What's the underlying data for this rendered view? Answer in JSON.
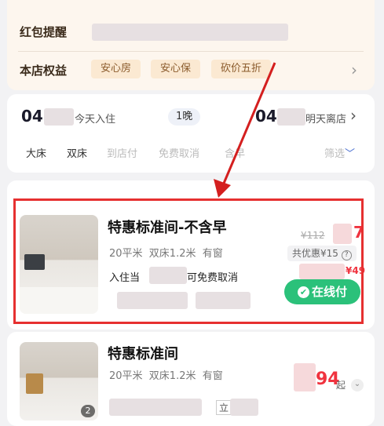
{
  "promo": {
    "label": "红包提醒",
    "benefits_label": "本店权益",
    "tags": [
      "安心房",
      "安心保",
      "砍价五折"
    ]
  },
  "dates": {
    "checkin_prefix": "04",
    "checkin_suffix": "今天入住",
    "nights": "1晚",
    "checkout_prefix": "04-",
    "checkout_suffix": "明天离店"
  },
  "filters": {
    "items": [
      "大床",
      "双床",
      "到店付",
      "免费取消",
      "含早"
    ],
    "more_label": "筛选"
  },
  "rooms": [
    {
      "title": "特惠标准间-不含早",
      "meta": "20平米  双床1.2米  有窗",
      "note": "入住当",
      "note_tail": "可免费取消",
      "original_price": "¥112",
      "discount_label": "共优惠¥15",
      "price_head": "7",
      "price_tail": "¥49",
      "pay_label": "在线付"
    },
    {
      "title": "特惠标准间",
      "meta": "20平米  双床1.2米  有窗",
      "price": "94",
      "price_suffix": "起",
      "photo_count": "2",
      "tag_chars": [
        "立"
      ]
    }
  ]
}
